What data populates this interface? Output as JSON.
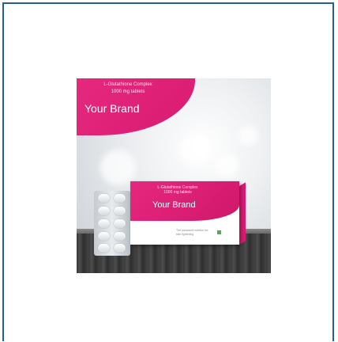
{
  "image": {
    "banner": {
      "line1": "L-Glutathione Complex",
      "line2": "1000 mg tablets",
      "brand": "Your Brand",
      "color": "#e6287f"
    },
    "box": {
      "line1": "L-Glutathione Complex",
      "line2": "1000 mg tablets",
      "brand": "Your Brand",
      "tagline1": "The advanced nutrition for",
      "tagline2": "skin lightening"
    },
    "frame_color": "#2c5d8f"
  }
}
